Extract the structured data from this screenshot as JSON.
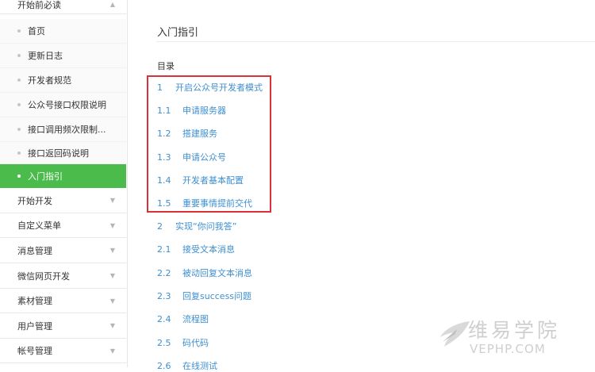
{
  "sidebar": {
    "groups": [
      {
        "label": "开始前必读",
        "caret": "▲"
      },
      {
        "label": "开始开发",
        "caret": "▼"
      },
      {
        "label": "自定义菜单",
        "caret": "▼"
      },
      {
        "label": "消息管理",
        "caret": "▼"
      },
      {
        "label": "微信网页开发",
        "caret": "▼"
      },
      {
        "label": "素材管理",
        "caret": "▼"
      },
      {
        "label": "用户管理",
        "caret": "▼"
      },
      {
        "label": "帐号管理",
        "caret": "▼"
      }
    ],
    "items": [
      {
        "label": "首页"
      },
      {
        "label": "更新日志"
      },
      {
        "label": "开发者规范"
      },
      {
        "label": "公众号接口权限说明"
      },
      {
        "label": "接口调用频次限制..."
      },
      {
        "label": "接口返回码说明"
      },
      {
        "label": "入门指引"
      }
    ]
  },
  "main": {
    "title": "入门指引",
    "toc_head": "目录",
    "toc": [
      {
        "num": "1",
        "label": "开启公众号开发者模式"
      },
      {
        "num": "1.1",
        "label": "申请服务器"
      },
      {
        "num": "1.2",
        "label": "搭建服务"
      },
      {
        "num": "1.3",
        "label": "申请公众号"
      },
      {
        "num": "1.4",
        "label": "开发者基本配置"
      },
      {
        "num": "1.5",
        "label": "重要事情提前交代"
      },
      {
        "num": "2",
        "label": "实现“你问我答”"
      },
      {
        "num": "2.1",
        "label": "接受文本消息"
      },
      {
        "num": "2.2",
        "label": "被动回复文本消息"
      },
      {
        "num": "2.3",
        "label": "回复success问题"
      },
      {
        "num": "2.4",
        "label": "流程图"
      },
      {
        "num": "2.5",
        "label": "码代码"
      },
      {
        "num": "2.6",
        "label": "在线测试"
      }
    ]
  },
  "watermark": {
    "cn": "维易学院",
    "en": "VEPHP.COM"
  },
  "colors": {
    "accent_green": "#4bbc4b",
    "link_blue": "#3d8fd1",
    "highlight_red": "#d9303a"
  }
}
